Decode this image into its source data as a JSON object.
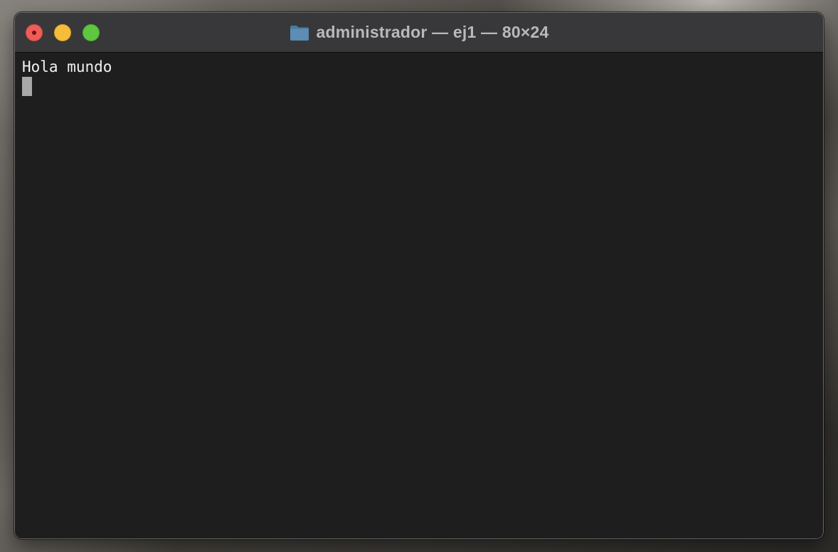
{
  "window": {
    "title": "administrador — ej1 — 80×24",
    "folder_icon": "folder-icon",
    "controls": {
      "close": "close-button",
      "minimize": "minimize-button",
      "zoom": "zoom-button"
    }
  },
  "terminal": {
    "lines": [
      "Hola mundo"
    ],
    "cursor_icon": "block-cursor"
  },
  "colors": {
    "terminal_bg": "#1e1e1e",
    "titlebar_bg": "#38383a",
    "text": "#f2f2f2",
    "close": "#ee5d57",
    "minimize": "#f5bd39",
    "zoom": "#5fc63f",
    "folder": "#5b8db5"
  }
}
